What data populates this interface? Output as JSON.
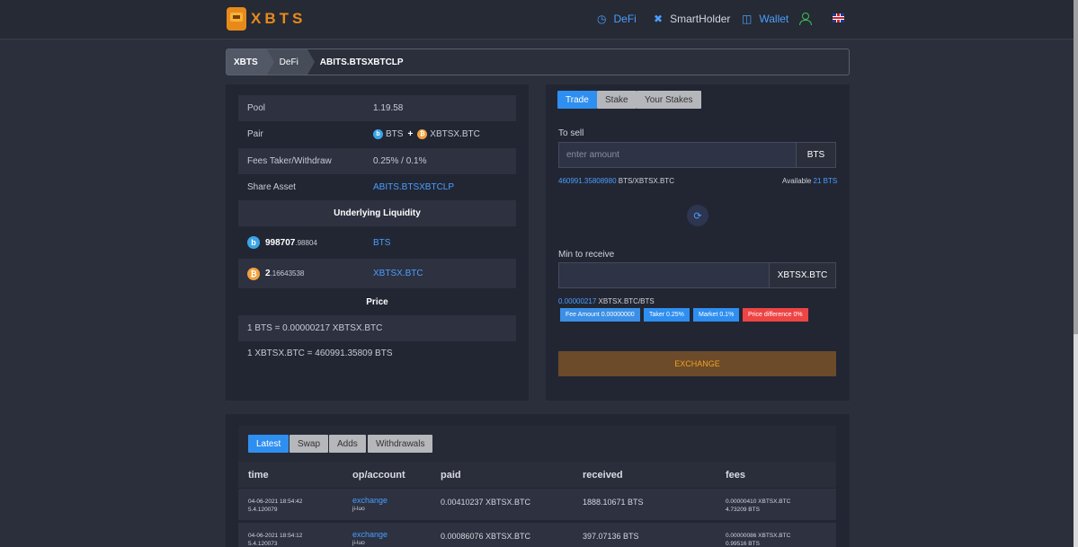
{
  "brand": {
    "logo_text": "XBTS"
  },
  "nav": {
    "defi": "DeFi",
    "smartholder": "SmartHolder",
    "wallet": "Wallet"
  },
  "breadcrumb": {
    "root": "XBTS",
    "section": "DeFi",
    "current": "ABITS.BTSXBTCLP"
  },
  "pool_info": {
    "pool_label": "Pool",
    "pool_value": "1.19.58",
    "pair_label": "Pair",
    "pair_a": "BTS",
    "pair_plus": "+",
    "pair_b": "XBTSX.BTC",
    "fees_label": "Fees Taker/Withdraw",
    "fees_value": "0.25% / 0.1%",
    "share_label": "Share Asset",
    "share_value": "ABITS.BTSXBTCLP",
    "underlying_title": "Underlying Liquidity",
    "liq_a_int": "998707",
    "liq_a_dec": ".98804",
    "liq_a_asset": "BTS",
    "liq_b_int": "2",
    "liq_b_dec": ".16643538",
    "liq_b_asset": "XBTSX.BTC",
    "price_title": "Price",
    "price_1": "1 BTS = 0.00000217 XBTSX.BTC",
    "price_2": "1 XBTSX.BTC = 460991.35809 BTS"
  },
  "trade": {
    "tabs": {
      "trade": "Trade",
      "stake": "Stake",
      "your_stakes": "Your Stakes"
    },
    "to_sell_label": "To sell",
    "sell_placeholder": "enter amount",
    "sell_unit": "BTS",
    "rate_value": "460991.35808980",
    "rate_unit": " BTS/XBTSX.BTC",
    "available_label": "Available ",
    "available_value": "21 BTS",
    "min_receive_label": "Min to receive",
    "receive_unit": "XBTSX.BTC",
    "rate2_value": "0.00000217",
    "rate2_unit": " XBTSX.BTC/BTS",
    "badges": {
      "fee": "Fee Amount 0.00000000",
      "taker": "Taker 0.25%",
      "market": "Market 0.1%",
      "price_diff": "Price difference 0%"
    },
    "exchange_label": "EXCHANGE"
  },
  "history": {
    "tabs": {
      "latest": "Latest",
      "swap": "Swap",
      "adds": "Adds",
      "withdrawals": "Withdrawals"
    },
    "columns": {
      "time": "time",
      "op": "op/account",
      "paid": "paid",
      "received": "received",
      "fees": "fees"
    },
    "rows": [
      {
        "time": "04-06-2021 18:54:42",
        "id": "5.4.120079",
        "op": "exchange",
        "account": "ji-luo",
        "paid": "0.00410237 XBTSX.BTC",
        "received": "1888.10671 BTS",
        "fee_1": "0.00000410 XBTSX.BTC",
        "fee_2": "4.73209 BTS"
      },
      {
        "time": "04-06-2021 18:54:12",
        "id": "5.4.120073",
        "op": "exchange",
        "account": "ji-luo",
        "paid": "0.00086076 XBTSX.BTC",
        "received": "397.07136 BTS",
        "fee_1": "0.00000086 XBTSX.BTC",
        "fee_2": "0.99516 BTS"
      }
    ]
  },
  "colors": {
    "accent": "#2f8ff0",
    "brand": "#e88a1a",
    "link": "#4a9eff",
    "exchange_bg": "#6b4b2a",
    "danger": "#ef4444"
  }
}
